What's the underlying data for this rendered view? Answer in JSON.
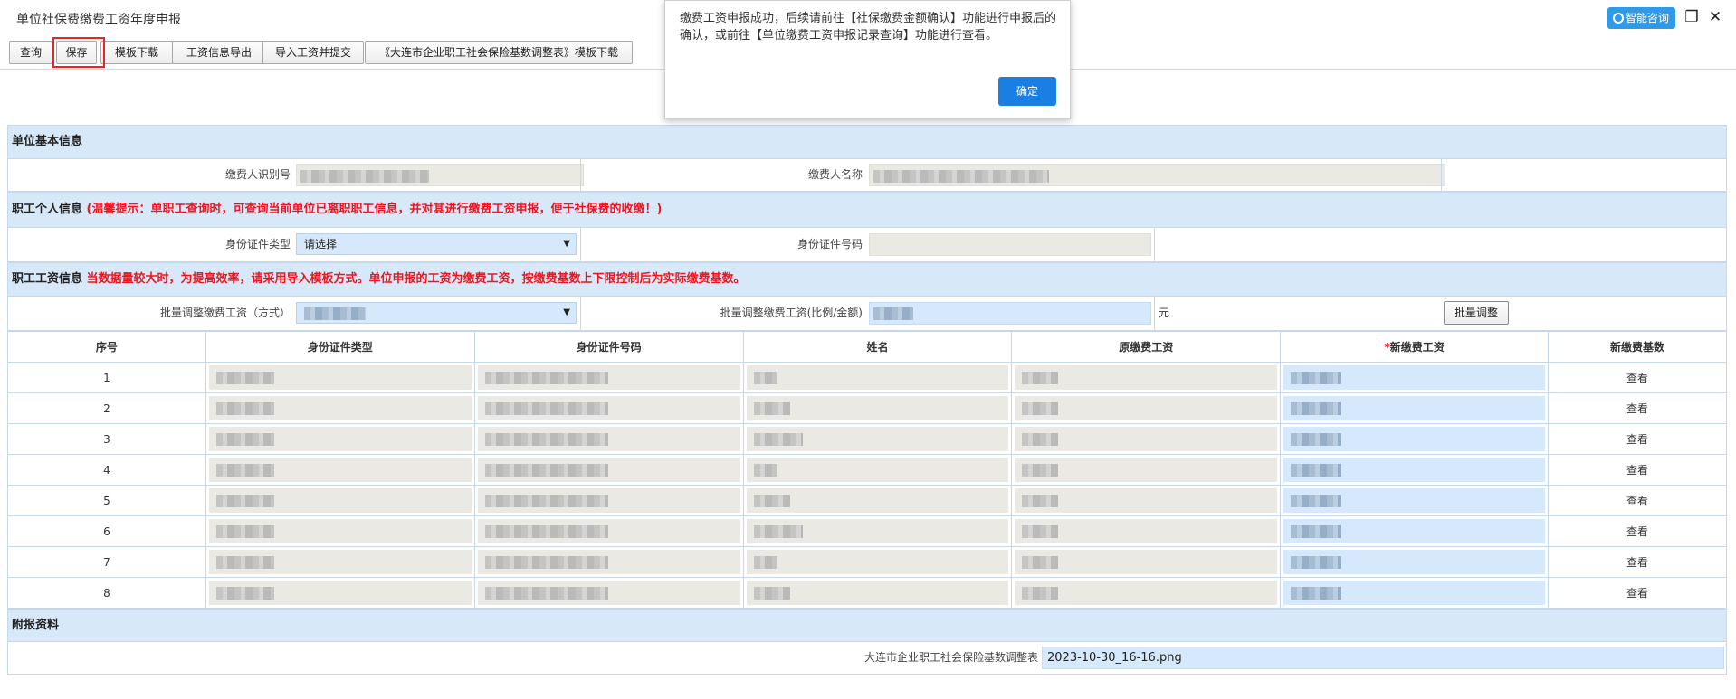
{
  "window": {
    "title": "单位社保费缴费工资年度申报",
    "ai_label": "智能咨询"
  },
  "toolbar": {
    "query": "查询",
    "save": "保存",
    "template_download": "模板下载",
    "export": "工资信息导出",
    "import_submit": "导入工资并提交",
    "adjust_template": "《大连市企业职工社会保险基数调整表》模板下载"
  },
  "dialog": {
    "message": "缴费工资申报成功，后续请前往【社保缴费金额确认】功能进行申报后的确认，或前往【单位缴费工资申报记录查询】功能进行查看。",
    "ok": "确定"
  },
  "unit_info": {
    "header": "单位基本信息",
    "payer_id_label": "缴费人识别号",
    "payer_name_label": "缴费人名称"
  },
  "personal_info": {
    "header": "职工个人信息",
    "hint": "(温馨提示：单职工查询时，可查询当前单位已离职职工信息，并对其进行缴费工资申报，便于社保费的收缴！)",
    "id_type_label": "身份证件类型",
    "id_type_value": "请选择",
    "id_number_label": "身份证件号码"
  },
  "wage_info": {
    "header": "职工工资信息",
    "hint": "当数据量较大时，为提高效率，请采用导入模板方式。单位申报的工资为缴费工资，按缴费基数上下限控制后为实际缴费基数。",
    "batch_mode_label": "批量调整缴费工资（方式）",
    "batch_value_label": "批量调整缴费工资(比例/金额)",
    "unit": "元",
    "batch_button": "批量调整"
  },
  "table": {
    "columns": [
      "序号",
      "身份证件类型",
      "身份证件号码",
      "姓名",
      "原缴费工资",
      "新缴费工资",
      "新缴费基数"
    ],
    "required_mark": "*",
    "rows": [
      {
        "no": "1",
        "action": "查看"
      },
      {
        "no": "2",
        "action": "查看"
      },
      {
        "no": "3",
        "action": "查看"
      },
      {
        "no": "4",
        "action": "查看"
      },
      {
        "no": "5",
        "action": "查看"
      },
      {
        "no": "6",
        "action": "查看"
      },
      {
        "no": "7",
        "action": "查看"
      },
      {
        "no": "8",
        "action": "查看"
      }
    ]
  },
  "attachment": {
    "header": "附报资料",
    "label": "大连市企业职工社会保险基数调整表",
    "file": "2023-10-30_16-16.png"
  },
  "colors": {
    "accent": "#1a7fe2",
    "section_bg": "#d7e8f8",
    "warning": "#f0141e",
    "highlight": "#e3262b"
  },
  "icons": [
    "headset-icon",
    "restore-window-icon",
    "close-icon",
    "dropdown-caret-icon"
  ]
}
